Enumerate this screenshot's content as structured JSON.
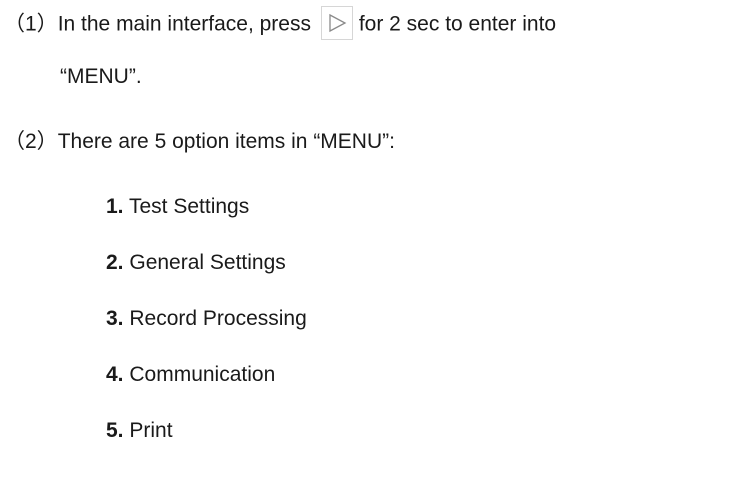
{
  "step1": {
    "marker": "（1）",
    "text_before_icon": "In the main interface, press",
    "icon": "play-triangle-icon",
    "text_after_icon": "for 2 sec to enter into",
    "continuation": "“MENU”."
  },
  "step2": {
    "marker": "（2）",
    "text": "There are 5 option items in “MENU”:"
  },
  "menu_items": [
    {
      "number": "1.",
      "label": "Test Settings"
    },
    {
      "number": "2.",
      "label": "General Settings"
    },
    {
      "number": "3.",
      "label": "Record Processing"
    },
    {
      "number": "4.",
      "label": "Communication"
    },
    {
      "number": "5.",
      "label": "Print"
    }
  ]
}
